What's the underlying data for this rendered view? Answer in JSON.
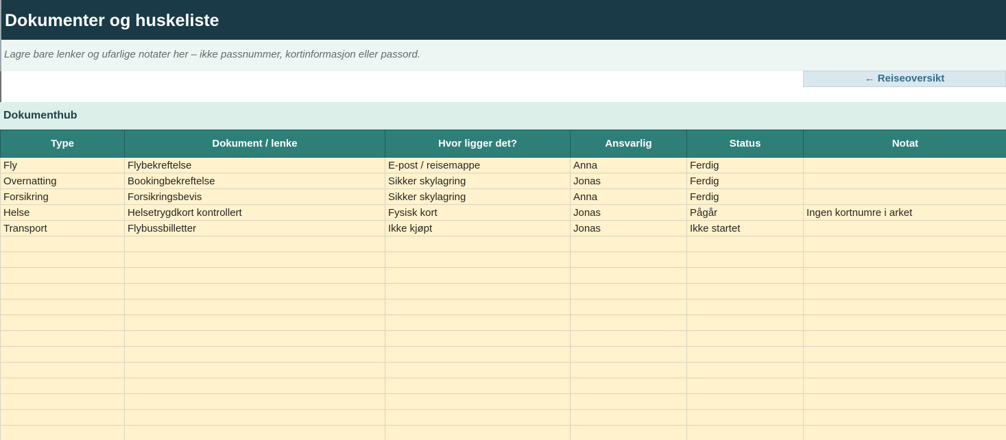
{
  "header": {
    "title": "Dokumenter og huskeliste",
    "note": "Lagre bare lenker og ufarlige notater her – ikke passnummer, kortinformasjon eller passord."
  },
  "nav": {
    "back_label": "← Reiseoversikt"
  },
  "section": {
    "title": "Dokumenthub"
  },
  "table": {
    "columns": [
      "Type",
      "Dokument / lenke",
      "Hvor ligger det?",
      "Ansvarlig",
      "Status",
      "Notat"
    ],
    "rows": [
      [
        "Fly",
        "Flybekreftelse",
        "E-post / reisemappe",
        "Anna",
        "Ferdig",
        ""
      ],
      [
        "Overnatting",
        "Bookingbekreftelse",
        "Sikker skylagring",
        "Jonas",
        "Ferdig",
        ""
      ],
      [
        "Forsikring",
        "Forsikringsbevis",
        "Sikker skylagring",
        "Anna",
        "Ferdig",
        ""
      ],
      [
        "Helse",
        "Helsetrygdkort kontrollert",
        "Fysisk kort",
        "Jonas",
        "Pågår",
        "Ingen kortnumre i arket"
      ],
      [
        "Transport",
        "Flybussbilletter",
        "Ikke kjøpt",
        "Jonas",
        "Ikke startet",
        ""
      ],
      [
        "",
        "",
        "",
        "",
        "",
        ""
      ],
      [
        "",
        "",
        "",
        "",
        "",
        ""
      ],
      [
        "",
        "",
        "",
        "",
        "",
        ""
      ],
      [
        "",
        "",
        "",
        "",
        "",
        ""
      ],
      [
        "",
        "",
        "",
        "",
        "",
        ""
      ],
      [
        "",
        "",
        "",
        "",
        "",
        ""
      ],
      [
        "",
        "",
        "",
        "",
        "",
        ""
      ],
      [
        "",
        "",
        "",
        "",
        "",
        ""
      ],
      [
        "",
        "",
        "",
        "",
        "",
        ""
      ],
      [
        "",
        "",
        "",
        "",
        "",
        ""
      ],
      [
        "",
        "",
        "",
        "",
        "",
        ""
      ],
      [
        "",
        "",
        "",
        "",
        "",
        ""
      ],
      [
        "",
        "",
        "",
        "",
        "",
        ""
      ],
      [
        "",
        "",
        "",
        "",
        "",
        ""
      ]
    ]
  }
}
